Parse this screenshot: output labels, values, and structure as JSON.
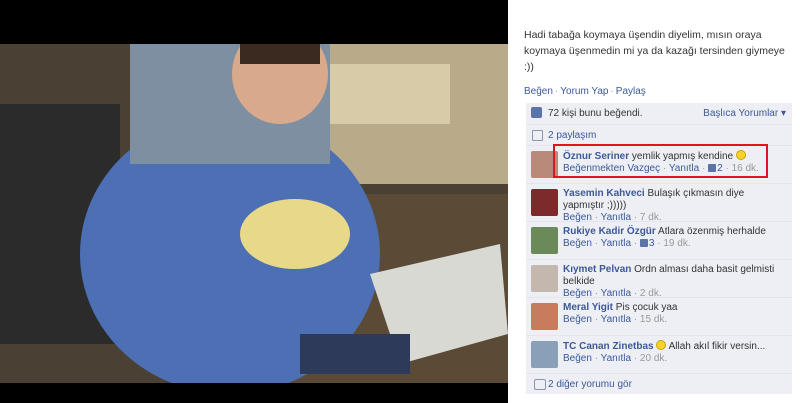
{
  "post": {
    "caption": "Hadi tabağa koymaya üşendin diyelim, mısın oraya koymaya üşenmedin mi ya da kazağı tersinden giymeye :))",
    "actions": [
      "Beğen",
      "Yorum Yap",
      "Paylaş"
    ]
  },
  "feedback": {
    "likes_text": "72 kişi bunu beğendi.",
    "sort_label": "Başlıca Yorumlar ▾",
    "shares_text": "2 paylaşım",
    "more_comments": "2 diğer yorumu gör"
  },
  "comments": [
    {
      "name": "Öznur Seriner",
      "text": "yemlik yapmış kendine",
      "meta": {
        "like": "Beğenmekten Vazgeç",
        "reply": "Yanıtla",
        "likes": "2",
        "time": "16 dk."
      },
      "avatar_color": "#b98a7a"
    },
    {
      "name": "Yasemin Kahveci",
      "text": "Bulaşık çıkmasın diye yapmıştır ;)))))",
      "meta": {
        "like": "Beğen",
        "reply": "Yanıtla",
        "likes": "",
        "time": "7 dk."
      },
      "avatar_color": "#7d2a2a"
    },
    {
      "name": "Rukiye Kadir Özgür",
      "text": "Atlara özenmiş herhalde",
      "meta": {
        "like": "Beğen",
        "reply": "Yanıtla",
        "likes": "3",
        "time": "19 dk."
      },
      "avatar_color": "#6a8a5a"
    },
    {
      "name": "Kıymet Pelvan",
      "text": "Ordn alması daha basit gelmisti belkide",
      "meta": {
        "like": "Beğen",
        "reply": "Yanıtla",
        "likes": "",
        "time": "2 dk."
      },
      "avatar_color": "#c4b8ae"
    },
    {
      "name": "Meral Yigit",
      "text": "Pis çocuk yaa",
      "meta": {
        "like": "Beğen",
        "reply": "Yanıtla",
        "likes": "",
        "time": "15 dk."
      },
      "avatar_color": "#c97b5d"
    },
    {
      "name": "TC Canan Zinetbas",
      "text": "Allah akıl fikir versin...",
      "meta": {
        "like": "Beğen",
        "reply": "Yanıtla",
        "likes": "",
        "time": "20 dk."
      },
      "avatar_color": "#8aa0b8"
    }
  ]
}
